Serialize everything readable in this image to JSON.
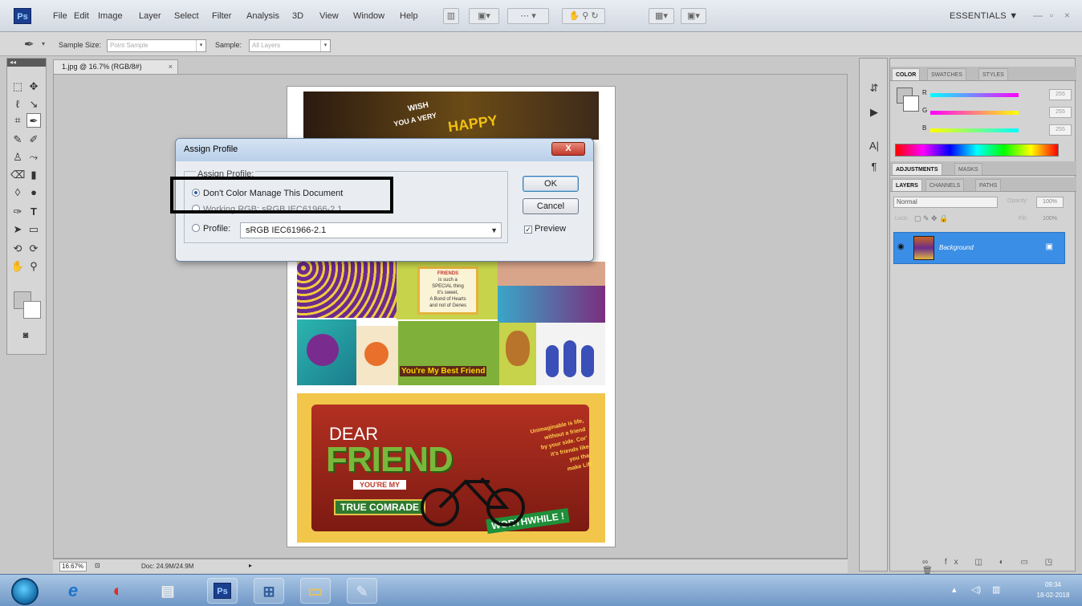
{
  "app": {
    "logo": "Ps",
    "menu": [
      "File",
      "Edit",
      "Image",
      "Layer",
      "Select",
      "Filter",
      "Analysis",
      "3D",
      "View",
      "Window",
      "Help"
    ],
    "workspace": "ESSENTIALS ▼",
    "window_controls": [
      "—",
      "▫",
      "×"
    ]
  },
  "options_bar": {
    "sample_size_label": "Sample Size:",
    "sample_size_value": "Point Sample",
    "sample_label": "Sample:",
    "sample_value": "All Layers"
  },
  "document": {
    "tab_title": "1.jpg @ 16.7% (RGB/8#)",
    "tab_close": "×",
    "zoom": "16.67%",
    "doc_size": "Doc: 24.9M/24.9M"
  },
  "canvas_art": {
    "wish1": "WISH",
    "wish2": "YOU A VERY",
    "happy": "HAPPY",
    "friends_card": "FRIENDS",
    "friends_lines": [
      "is such a",
      "SPECIAL thing",
      "it's sweet,",
      "A Bond of Hearts",
      "and not of Genes"
    ],
    "best_friend": "You're My Best Friend",
    "dear": "DEAR",
    "friend": "FRIEND",
    "youre_my": "YOU'RE MY",
    "true_comrade": "TRUE COMRADE",
    "worthwhile": "WORTHWHILE !",
    "quote": [
      "Unimaginable is life,",
      "without a friend",
      "by your side. Cor'",
      "it's friends like",
      "you that",
      "make Life"
    ]
  },
  "dialog": {
    "title": "Assign Profile",
    "close": "X",
    "group_label": "Assign Profile:",
    "options": [
      {
        "label": "Don't Color Manage This Document",
        "checked": true
      },
      {
        "label": "Working RGB:  sRGB IEC61966-2.1",
        "checked": false
      },
      {
        "label": "Profile:",
        "checked": false
      }
    ],
    "profile_value": "sRGB IEC61966-2.1",
    "ok": "OK",
    "cancel": "Cancel",
    "preview": "Preview",
    "preview_checked": true
  },
  "panels": {
    "color_tabs": [
      "COLOR",
      "SWATCHES",
      "STYLES"
    ],
    "color_channels": [
      {
        "name": "R",
        "value": "255"
      },
      {
        "name": "G",
        "value": "255"
      },
      {
        "name": "B",
        "value": "255"
      }
    ],
    "adjust_tabs": [
      "ADJUSTMENTS",
      "MASKS"
    ],
    "layer_tabs": [
      "LAYERS",
      "CHANNELS",
      "PATHS"
    ],
    "blend_mode": "Normal",
    "opacity_label": "Opacity:",
    "opacity": "100%",
    "lock_label": "Lock:",
    "fill_label": "Fill:",
    "fill": "100%",
    "layer_name": "Background"
  },
  "taskbar": {
    "apps": [
      "e",
      "◐",
      "▤",
      "Ps",
      "⊞",
      "▭",
      "✎"
    ],
    "time": "09:34",
    "date": "18-02-2018"
  }
}
